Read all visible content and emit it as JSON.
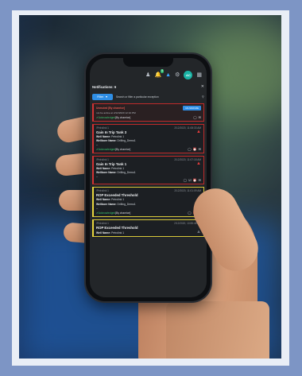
{
  "app": {
    "notifications_title": "Notifications: 6",
    "filter_label": "Filter",
    "search_placeholder": "Search or filter a particular exception"
  },
  "topbar": {
    "notif_badge": "5",
    "avatar_initials": "AC"
  },
  "cards": [
    {
      "type": "pinned",
      "status": "Unmuted [By chanrice]",
      "detail": "not be active at 2/12/2020 12:10 PM",
      "button": "UN-SNOOZE"
    },
    {
      "source": "Petrolink 1",
      "time": "2/12/2020, 11:08:33 AM",
      "title": "Gain In Trip Tank 3",
      "well_label": "Well Name:",
      "well_value": "Petrolink 1",
      "wellbore_label": "Wellbore Name:",
      "wellbore_value": "Drilling_Demo1",
      "dash": "--",
      "ack_label": "Acknowledged",
      "ack_by": "[By chanrice]",
      "border": "red"
    },
    {
      "source": "Petrolink 1",
      "time": "2/12/2020, 11:07:18 AM",
      "title": "Gain In Trip Tank 1",
      "well_label": "Well Name:",
      "well_value": "Petrolink 1",
      "wellbore_label": "Wellbore Name:",
      "wellbore_value": "Drilling_Demo1",
      "dash": "--",
      "border": "red"
    },
    {
      "source": "Petrolink 1",
      "time": "2/12/2020, 11:01:09 AM",
      "title": "ROP Exceeded Threshold",
      "well_label": "Well Name:",
      "well_value": "Petrolink 1",
      "wellbore_label": "Wellbore Name:",
      "wellbore_value": "Drilling_Demo1",
      "dash": "--",
      "ack_label": "Acknowledged",
      "ack_by": "[By chanrice]",
      "border": "yellow"
    },
    {
      "source": "Petrolink 1",
      "time": "2/12/2020, 10:55:48 AM",
      "title": "ROP Exceeded Threshold",
      "well_label": "Well Name:",
      "well_value": "Petrolink 1",
      "border": "yellow"
    }
  ],
  "colors": {
    "accent": "#2f8ee5",
    "alert_red": "#d23333",
    "warn_yellow": "#e8d63e",
    "ack_green": "#3ac46f"
  }
}
